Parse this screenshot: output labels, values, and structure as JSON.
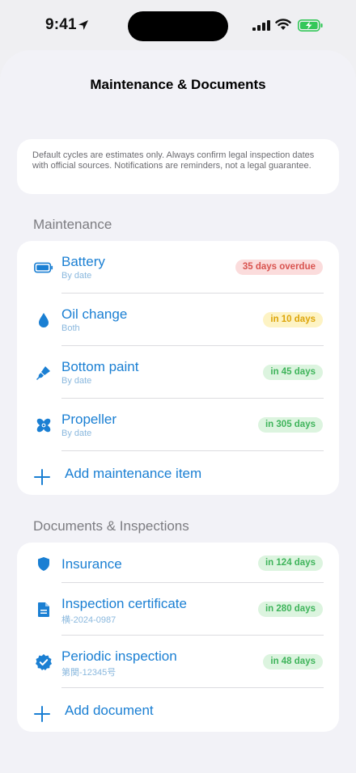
{
  "status_bar": {
    "time": "9:41"
  },
  "sheet": {
    "title": "Maintenance & Documents"
  },
  "notice": {
    "text": "Default cycles are estimates only. Always confirm legal inspection dates with official sources. Notifications are reminders, not a legal guarantee."
  },
  "maintenance": {
    "header": "Maintenance",
    "items": [
      {
        "title": "Battery",
        "subtitle": "By date",
        "badge": "35 days overdue",
        "status": "overdue",
        "icon": "battery-icon"
      },
      {
        "title": "Oil change",
        "subtitle": "Both",
        "badge": "in 10 days",
        "status": "soon",
        "icon": "drop-icon"
      },
      {
        "title": "Bottom paint",
        "subtitle": "By date",
        "badge": "in 45 days",
        "status": "ok",
        "icon": "paintbrush-icon"
      },
      {
        "title": "Propeller",
        "subtitle": "By date",
        "badge": "in 305 days",
        "status": "ok",
        "icon": "fan-icon"
      }
    ],
    "add_label": "Add maintenance item"
  },
  "documents": {
    "header": "Documents & Inspections",
    "items": [
      {
        "title": "Insurance",
        "subtitle": "",
        "badge": "in 124 days",
        "status": "ok",
        "icon": "shield-icon"
      },
      {
        "title": "Inspection certificate",
        "subtitle": "横-2024-0987",
        "badge": "in 280 days",
        "status": "ok",
        "icon": "document-icon"
      },
      {
        "title": "Periodic inspection",
        "subtitle": "第関-12345号",
        "badge": "in 48 days",
        "status": "ok",
        "icon": "checkmark-seal-icon"
      }
    ],
    "add_label": "Add document"
  },
  "colors": {
    "accent": "#1a7fd3",
    "overdue": "#d9534f",
    "soon": "#dda50a",
    "ok": "#3fb45b"
  }
}
